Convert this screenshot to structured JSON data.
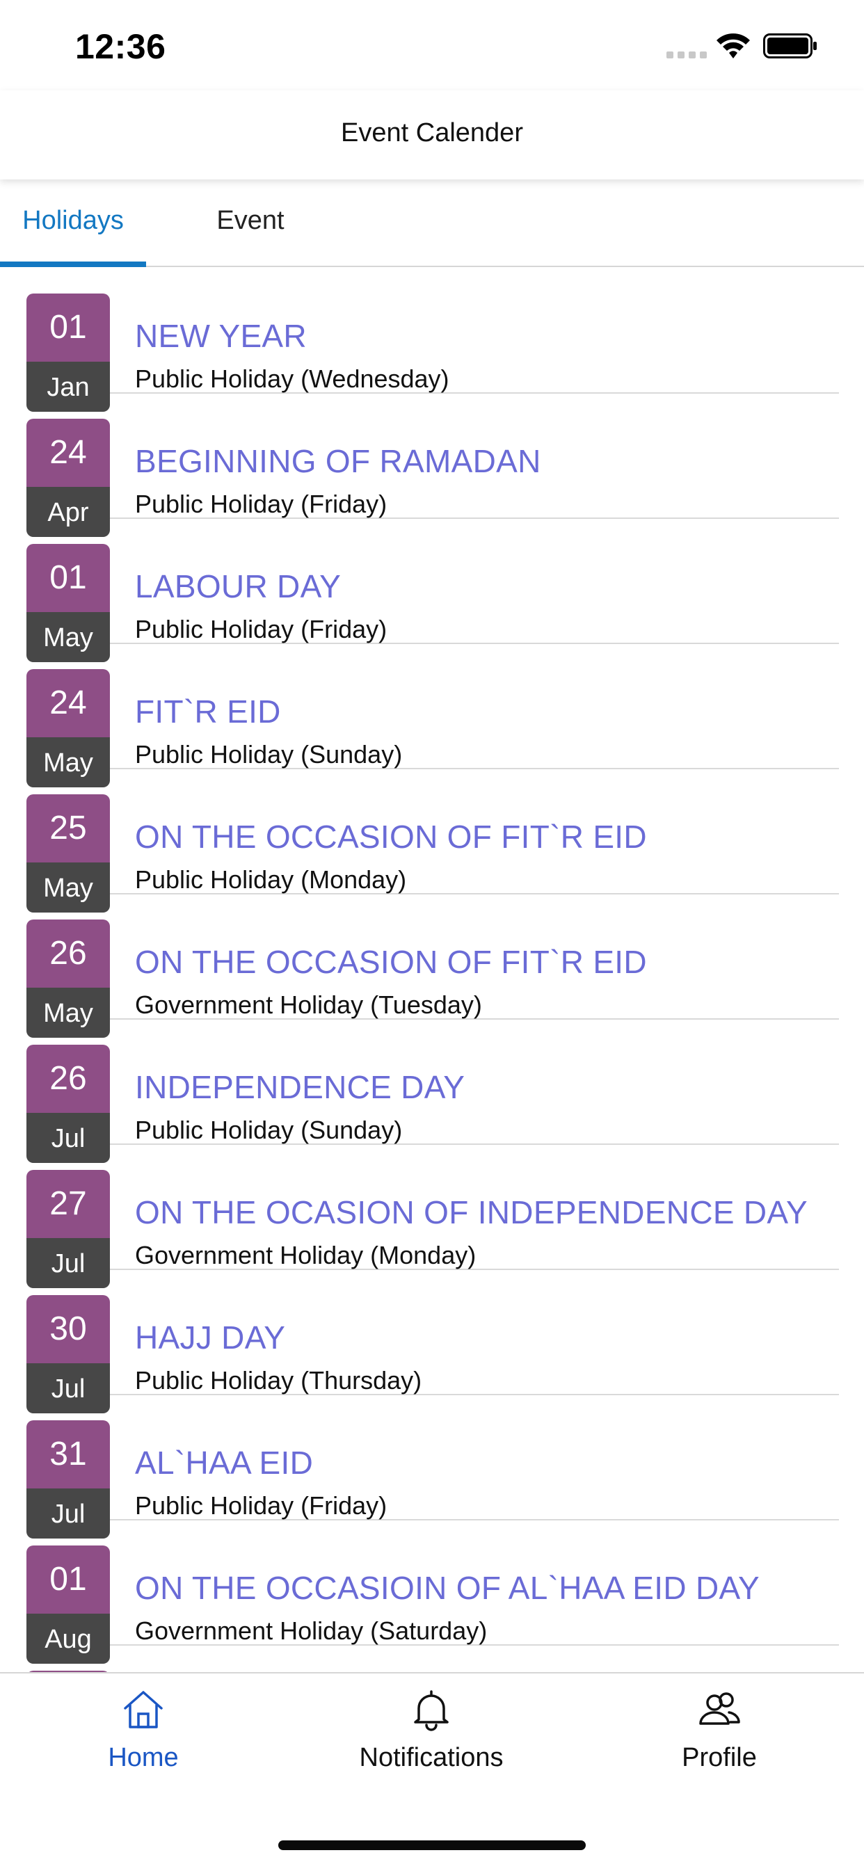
{
  "status_bar": {
    "time": "12:36"
  },
  "nav": {
    "title": "Event Calender"
  },
  "tabs": [
    {
      "label": "Holidays",
      "active": true
    },
    {
      "label": "Event",
      "active": false
    }
  ],
  "colors": {
    "accent": "#1378c2",
    "holiday_title": "#6a6bd6",
    "badge_day": "#8e4e86",
    "badge_month": "#474747"
  },
  "holidays": [
    {
      "day": "01",
      "month": "Jan",
      "name": "NEW YEAR",
      "type": "Public Holiday (Wednesday)"
    },
    {
      "day": "24",
      "month": "Apr",
      "name": "BEGINNING OF RAMADAN",
      "type": "Public Holiday (Friday)"
    },
    {
      "day": "01",
      "month": "May",
      "name": "LABOUR DAY",
      "type": "Public Holiday (Friday)"
    },
    {
      "day": "24",
      "month": "May",
      "name": "FIT`R EID",
      "type": "Public Holiday (Sunday)"
    },
    {
      "day": "25",
      "month": "May",
      "name": "ON THE OCCASION OF FIT`R EID",
      "type": "Public Holiday (Monday)"
    },
    {
      "day": "26",
      "month": "May",
      "name": "ON THE OCCASION OF FIT`R EID",
      "type": "Government Holiday (Tuesday)"
    },
    {
      "day": "26",
      "month": "Jul",
      "name": "INDEPENDENCE DAY",
      "type": "Public Holiday (Sunday)"
    },
    {
      "day": "27",
      "month": "Jul",
      "name": "ON THE OCASION OF INDEPENDENCE DAY",
      "type": "Government Holiday (Monday)"
    },
    {
      "day": "30",
      "month": "Jul",
      "name": "HAJJ DAY",
      "type": "Public Holiday (Thursday)"
    },
    {
      "day": "31",
      "month": "Jul",
      "name": "AL`HAA EID",
      "type": "Public Holiday (Friday)"
    },
    {
      "day": "01",
      "month": "Aug",
      "name": "ON THE OCCASIOIN OF AL`HAA EID DAY",
      "type": "Government Holiday (Saturday)"
    }
  ],
  "tab_bar": {
    "home": {
      "label": "Home",
      "icon": "home-icon"
    },
    "notifications": {
      "label": "Notifications",
      "icon": "bell-icon"
    },
    "profile": {
      "label": "Profile",
      "icon": "users-icon"
    }
  }
}
